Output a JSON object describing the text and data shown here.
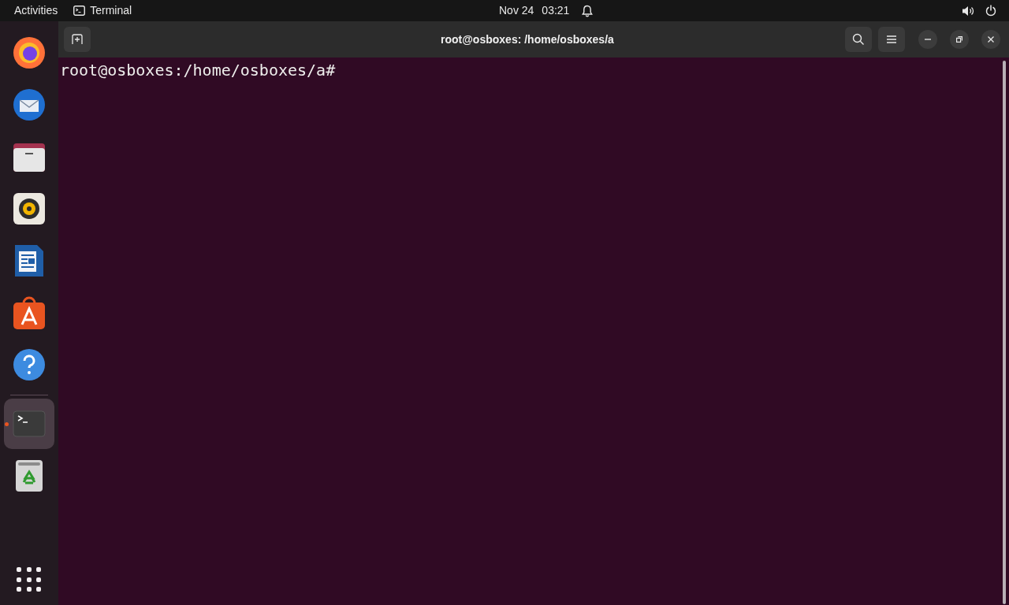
{
  "top_bar": {
    "activities": "Activities",
    "app_menu": "Terminal",
    "date": "Nov 24",
    "time": "03:21"
  },
  "dock": [
    {
      "kind": "browser",
      "running": false,
      "selected": false
    },
    {
      "kind": "mail",
      "running": false,
      "selected": false
    },
    {
      "kind": "files",
      "running": false,
      "selected": false
    },
    {
      "kind": "music",
      "running": false,
      "selected": false
    },
    {
      "kind": "writer",
      "running": false,
      "selected": false
    },
    {
      "kind": "software",
      "running": false,
      "selected": false
    },
    {
      "kind": "help",
      "running": false,
      "selected": false
    },
    {
      "kind": "terminal",
      "running": true,
      "selected": true
    },
    {
      "kind": "trash",
      "running": false,
      "selected": false
    }
  ],
  "window": {
    "title": "root@osboxes: /home/osboxes/a"
  },
  "terminal": {
    "lines": [
      "root@osboxes:/home/osboxes/a#"
    ]
  }
}
